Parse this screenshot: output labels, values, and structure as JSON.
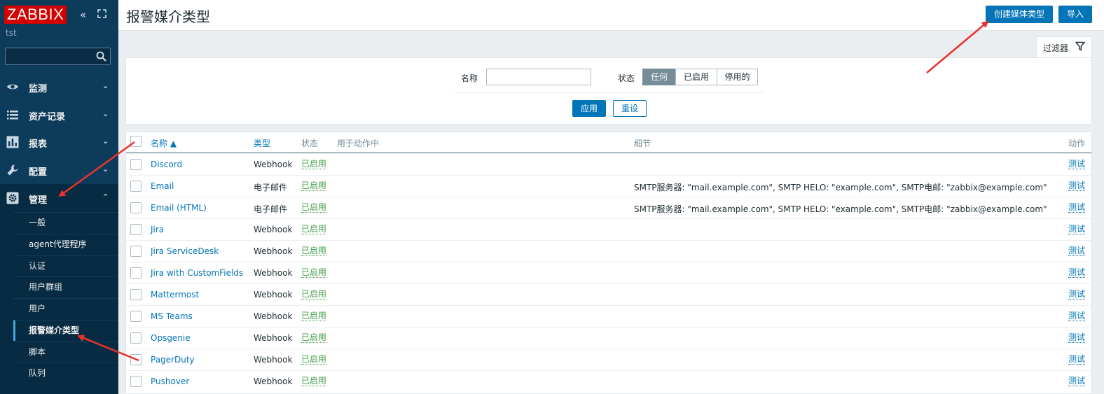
{
  "sidebar": {
    "brand": "ZABBIX",
    "server_name": "tst",
    "menu": [
      {
        "label": "监测",
        "icon": "eye-icon"
      },
      {
        "label": "资产记录",
        "icon": "list-icon"
      },
      {
        "label": "报表",
        "icon": "bar-chart-icon"
      },
      {
        "label": "配置",
        "icon": "wrench-icon"
      },
      {
        "label": "管理",
        "icon": "gear-icon"
      }
    ],
    "submenu": [
      "一般",
      "agent代理程序",
      "认证",
      "用户群组",
      "用户",
      "报警媒介类型",
      "脚本",
      "队列"
    ]
  },
  "header": {
    "title": "报警媒介类型",
    "create_label": "创建媒体类型",
    "import_label": "导入"
  },
  "filter": {
    "tab_label": "过滤器",
    "name_label": "名称",
    "name_value": "",
    "status_label": "状态",
    "status_options": [
      "任何",
      "已启用",
      "停用的"
    ],
    "status_selected": "任何",
    "apply_label": "应用",
    "reset_label": "重设"
  },
  "table": {
    "columns": {
      "name": "名称 ▲",
      "type": "类型",
      "status": "状态",
      "used_in": "用于动作中",
      "details": "细节",
      "action": "动作"
    },
    "rows": [
      {
        "name": "Discord",
        "type": "Webhook",
        "status": "已启用",
        "details": "",
        "action": "测试"
      },
      {
        "name": "Email",
        "type": "电子邮件",
        "status": "已启用",
        "details": "SMTP服务器: \"mail.example.com\", SMTP HELO: \"example.com\", SMTP电邮: \"zabbix@example.com\"",
        "action": "测试"
      },
      {
        "name": "Email (HTML)",
        "type": "电子邮件",
        "status": "已启用",
        "details": "SMTP服务器: \"mail.example.com\", SMTP HELO: \"example.com\", SMTP电邮: \"zabbix@example.com\"",
        "action": "测试"
      },
      {
        "name": "Jira",
        "type": "Webhook",
        "status": "已启用",
        "details": "",
        "action": "测试"
      },
      {
        "name": "Jira ServiceDesk",
        "type": "Webhook",
        "status": "已启用",
        "details": "",
        "action": "测试"
      },
      {
        "name": "Jira with CustomFields",
        "type": "Webhook",
        "status": "已启用",
        "details": "",
        "action": "测试"
      },
      {
        "name": "Mattermost",
        "type": "Webhook",
        "status": "已启用",
        "details": "",
        "action": "测试"
      },
      {
        "name": "MS Teams",
        "type": "Webhook",
        "status": "已启用",
        "details": "",
        "action": "测试"
      },
      {
        "name": "Opsgenie",
        "type": "Webhook",
        "status": "已启用",
        "details": "",
        "action": "测试"
      },
      {
        "name": "PagerDuty",
        "type": "Webhook",
        "status": "已启用",
        "details": "",
        "action": "测试"
      },
      {
        "name": "Pushover",
        "type": "Webhook",
        "status": "已启用",
        "details": "",
        "action": "测试"
      }
    ]
  },
  "colors": {
    "sidebar_bg": "#0d3c5b",
    "brand_red": "#d40000",
    "link_blue": "#0275b8",
    "status_green": "#429e47",
    "annotation_red": "#e8322d"
  }
}
